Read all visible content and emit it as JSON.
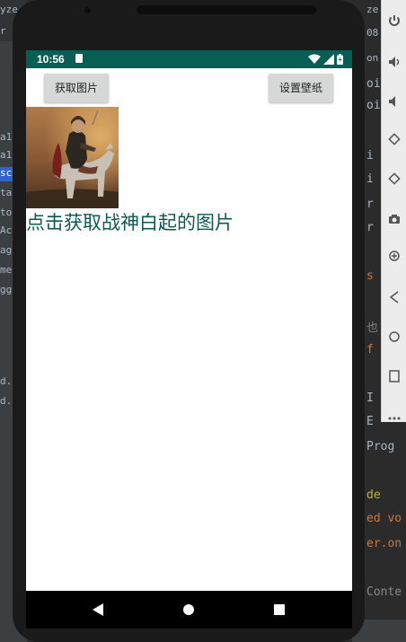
{
  "ide": {
    "left_items": [
      "yze",
      "r",
      "a1",
      "a1",
      "sc",
      "tai",
      "to",
      "Ac",
      "ag",
      "me",
      "gg",
      "d.:",
      "d.x"
    ],
    "right_lines": [
      {
        "text": "ze",
        "top": 0,
        "tone": "normal"
      },
      {
        "text": "08",
        "top": 0,
        "tone": "normal"
      },
      {
        "text": "on",
        "top": 0,
        "tone": "normal"
      }
    ],
    "code_lines": [
      {
        "text": "oi",
        "tone": "normal"
      },
      {
        "text": "oi",
        "tone": "normal"
      },
      {
        "text": "i",
        "tone": "normal"
      },
      {
        "text": "i",
        "tone": "normal"
      },
      {
        "text": "r",
        "tone": "normal"
      },
      {
        "text": "r",
        "tone": "normal"
      },
      {
        "text": "s",
        "tone": "orange"
      },
      {
        "text": "也",
        "tone": "normal"
      },
      {
        "text": "f",
        "tone": "orange"
      },
      {
        "text": "I",
        "tone": "normal"
      },
      {
        "text": "E",
        "tone": "normal"
      },
      {
        "text": "Prog",
        "tone": "normal"
      },
      {
        "text": "de",
        "tone": "yellow"
      },
      {
        "text": "ed vo",
        "tone": "orange"
      },
      {
        "text": "er.on",
        "tone": "orange"
      },
      {
        "text": "Conte",
        "tone": "normal"
      }
    ]
  },
  "emulator_toolbar": {
    "tools": [
      "power-icon",
      "volume-up-icon",
      "volume-down-icon",
      "rotate-left-icon",
      "rotate-right-icon",
      "camera-icon",
      "zoom-icon",
      "back-icon",
      "home-icon",
      "overview-icon",
      "more-icon"
    ]
  },
  "status_bar": {
    "time": "10:56",
    "background": "#075e54"
  },
  "app": {
    "get_image_button": "获取图片",
    "set_wallpaper_button": "设置壁纸",
    "caption": "点击获取战神白起的图片",
    "caption_color": "#0b5a52"
  },
  "nav_bar": {
    "back": "back-icon",
    "home": "home-icon",
    "recents": "recents-icon"
  }
}
